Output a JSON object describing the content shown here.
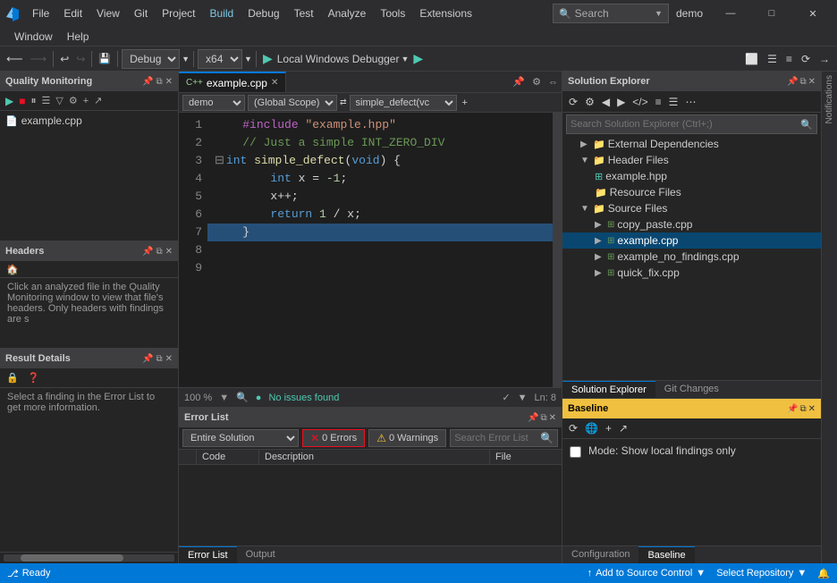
{
  "app": {
    "title": "demo",
    "logo_icon": "vs-logo"
  },
  "menubar": {
    "items": [
      "File",
      "Edit",
      "View",
      "Git",
      "Project",
      "Build",
      "Debug",
      "Test",
      "Analyze",
      "Tools",
      "Extensions"
    ],
    "search_placeholder": "Search",
    "search_label": "Search",
    "window_label": "Window",
    "help_label": "Help"
  },
  "toolbar": {
    "config_label": "Debug",
    "platform_label": "x64",
    "debugger_label": "Local Windows Debugger"
  },
  "quality_monitoring": {
    "title": "Quality Monitoring",
    "files": [
      "example.cpp"
    ]
  },
  "headers": {
    "title": "Headers",
    "description": "Click an analyzed file in the Quality Monitoring window to view that file's headers. Only headers with findings are s"
  },
  "result_details": {
    "title": "Result Details",
    "description": "Select a finding in the Error List to get more information."
  },
  "editor": {
    "filename": "example.cpp",
    "project": "demo",
    "scope": "(Global Scope)",
    "function": "simple_defect(vc",
    "zoom": "100 %",
    "status": "No issues found",
    "line_info": "Ln: 8",
    "lines": [
      {
        "num": "1",
        "code": "    #include \"example.hpp\""
      },
      {
        "num": "2",
        "code": ""
      },
      {
        "num": "3",
        "code": "    // Just a simple INT_ZERO_DIV"
      },
      {
        "num": "4",
        "code": "    int simple_defect(void) {"
      },
      {
        "num": "5",
        "code": "        int x = -1;"
      },
      {
        "num": "6",
        "code": "        x++;"
      },
      {
        "num": "7",
        "code": "        return 1 / x;"
      },
      {
        "num": "8",
        "code": "    }"
      },
      {
        "num": "9",
        "code": ""
      }
    ]
  },
  "error_list": {
    "title": "Error List",
    "solution_option": "Entire Solution",
    "errors_count": "0 Errors",
    "warnings_count": "0 Warnings",
    "search_placeholder": "Search Error List",
    "cols": [
      "Code",
      "Description",
      "File"
    ],
    "tabs": [
      "Error List",
      "Output"
    ]
  },
  "solution_explorer": {
    "title": "Solution Explorer",
    "search_placeholder": "Search Solution Explorer (Ctrl+;)",
    "tree": [
      {
        "indent": 0,
        "arrow": "▶",
        "icon": "📁",
        "name": "External Dependencies"
      },
      {
        "indent": 0,
        "arrow": "▼",
        "icon": "📁",
        "name": "Header Files"
      },
      {
        "indent": 1,
        "arrow": " ",
        "icon": "📄",
        "name": "example.hpp"
      },
      {
        "indent": 1,
        "arrow": " ",
        "icon": "📁",
        "name": "Resource Files"
      },
      {
        "indent": 0,
        "arrow": "▼",
        "icon": "📁",
        "name": "Source Files"
      },
      {
        "indent": 1,
        "arrow": " ",
        "icon": "📄",
        "name": "copy_paste.cpp"
      },
      {
        "indent": 1,
        "arrow": " ",
        "icon": "📄",
        "name": "example.cpp",
        "selected": true
      },
      {
        "indent": 1,
        "arrow": " ",
        "icon": "📄",
        "name": "example_no_findings.cpp"
      },
      {
        "indent": 1,
        "arrow": " ",
        "icon": "📄",
        "name": "quick_fix.cpp"
      }
    ],
    "tabs": [
      "Solution Explorer",
      "Git Changes"
    ]
  },
  "baseline": {
    "title": "Baseline",
    "mode_label": "Mode: Show local findings only",
    "tabs": [
      "Configuration",
      "Baseline"
    ]
  },
  "notifications": {
    "label": "Notifications"
  },
  "statusbar": {
    "ready": "Ready",
    "source_control": "Add to Source Control",
    "select_repo": "Select Repository"
  }
}
